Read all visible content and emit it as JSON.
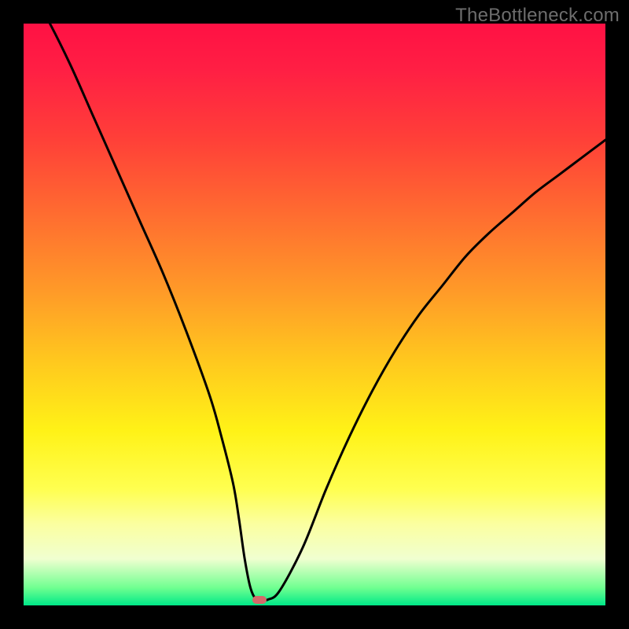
{
  "watermark": {
    "text": "TheBottleneck.com"
  },
  "chart_data": {
    "type": "line",
    "title": "",
    "xlabel": "",
    "ylabel": "",
    "xlim": [
      0,
      100
    ],
    "ylim": [
      0,
      100
    ],
    "grid": false,
    "legend": false,
    "notch_x": 38,
    "marker": {
      "x": 40.5,
      "y": 1.0,
      "color": "#d46a6a"
    },
    "gradient_colors": {
      "top": "#ff1144",
      "mid_upper": "#ff9a28",
      "mid": "#ffff50",
      "bottom": "#00e888"
    },
    "series": [
      {
        "name": "bottleneck-curve",
        "x": [
          0,
          4,
          8,
          12,
          16,
          20,
          24,
          28,
          32,
          34,
          36,
          37,
          38,
          39,
          40,
          41,
          42,
          44,
          48,
          52,
          56,
          60,
          64,
          68,
          72,
          76,
          80,
          84,
          88,
          92,
          96,
          100
        ],
        "y": [
          108,
          101,
          93,
          84,
          75,
          66,
          57,
          47,
          36,
          29,
          21,
          15,
          8,
          3,
          1,
          1,
          1,
          2.5,
          10,
          20,
          29,
          37,
          44,
          50,
          55,
          60,
          64,
          67.5,
          71,
          74,
          77,
          80
        ]
      }
    ]
  }
}
